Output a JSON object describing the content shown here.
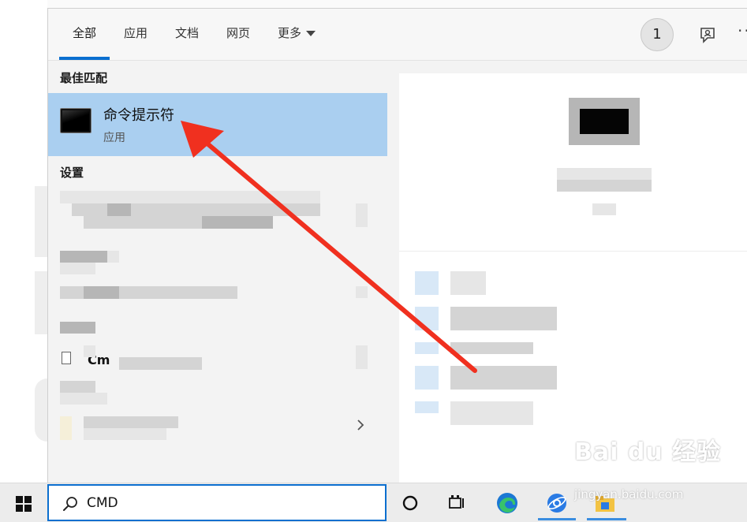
{
  "tabs": {
    "all": "全部",
    "apps": "应用",
    "docs": "文档",
    "web": "网页",
    "more": "更多"
  },
  "header": {
    "badge_count": "1",
    "more_dots": "···"
  },
  "best_match": {
    "section": "最佳匹配",
    "title": "命令提示符",
    "subtitle": "应用"
  },
  "settings": {
    "section": "设置"
  },
  "file_result": {
    "label_prefix": "Cm"
  },
  "taskbar": {
    "search_value": "CMD"
  },
  "watermark": {
    "brand": "Bai du 经验",
    "url": "jingyan.baidu.com"
  },
  "colors": {
    "accent": "#0b6fcf",
    "selection": "#aacff0",
    "arrow": "#f0301f"
  },
  "icons": [
    "windows-logo-icon",
    "search-icon",
    "cortana-icon",
    "task-view-icon",
    "edge-icon",
    "browser-icon",
    "file-explorer-icon",
    "feedback-icon",
    "command-prompt-icon",
    "file-icon",
    "chevron-right-icon",
    "chevron-down-icon"
  ]
}
